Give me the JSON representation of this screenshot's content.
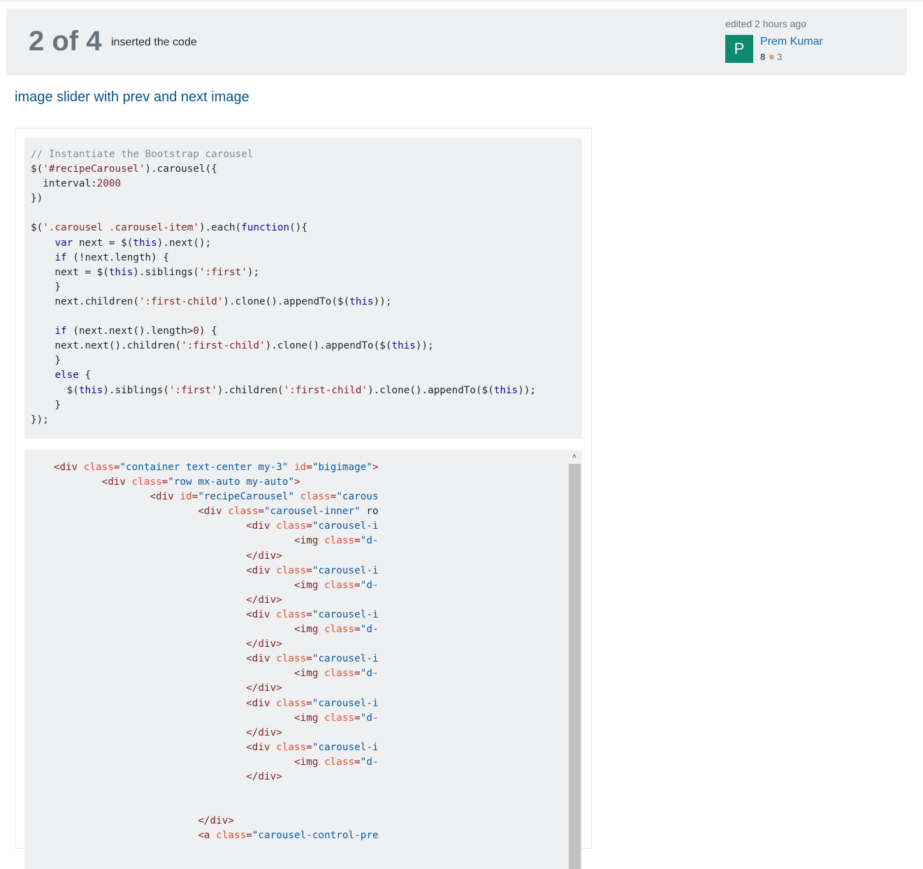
{
  "revision": {
    "number_label": "2 of 4",
    "comment": "inserted the code"
  },
  "editor": {
    "action_label": "edited 2 hours ago",
    "avatar_letter": "P",
    "avatar_color": "#0e8a6f",
    "name": "Prem Kumar",
    "reputation": "8",
    "bronze_badges": "3",
    "bronze_color": "#d1a684"
  },
  "post": {
    "title": "image slider with prev and next image"
  },
  "code_block_1": {
    "language": "javascript",
    "lines": [
      "// Instantiate the Bootstrap carousel",
      "$('#recipeCarousel').carousel({",
      "  interval:2000",
      "})",
      "",
      "$('.carousel .carousel-item').each(function(){",
      "    var next = $(this).next();",
      "    if (!next.length) {",
      "    next = $(this).siblings(':first');",
      "    }",
      "    next.children(':first-child').clone().appendTo($(this));",
      "",
      "    if (next.next().length>0) {",
      "    next.next().children(':first-child').clone().appendTo($(this));",
      "    }",
      "    else {",
      "      $(this).siblings(':first').children(':first-child').clone().appendTo($(this));",
      "    }",
      "});"
    ]
  },
  "code_block_2": {
    "language": "html",
    "lines": [
      "<div class=\"container text-center my-3\" id=\"bigimage\">",
      "<div class=\"row mx-auto my-auto\">",
      "<div id=\"recipeCarousel\" class=\"carous",
      "<div class=\"carousel-inner\" ro",
      "<div class=\"carousel-i",
      "<img class=\"d-",
      "</div>",
      "<div class=\"carousel-i",
      "<img class=\"d-",
      "</div>",
      "<div class=\"carousel-i",
      "<img class=\"d-",
      "</div>",
      "<div class=\"carousel-i",
      "<img class=\"d-",
      "</div>",
      "<div class=\"carousel-i",
      "<img class=\"d-",
      "</div>",
      "<div class=\"carousel-i",
      "<img class=\"d-",
      "</div>",
      "",
      "",
      "</div>",
      "<a class=\"carousel-control-pre"
    ]
  },
  "icons": {
    "scroll_up": "chevron-up-icon"
  }
}
